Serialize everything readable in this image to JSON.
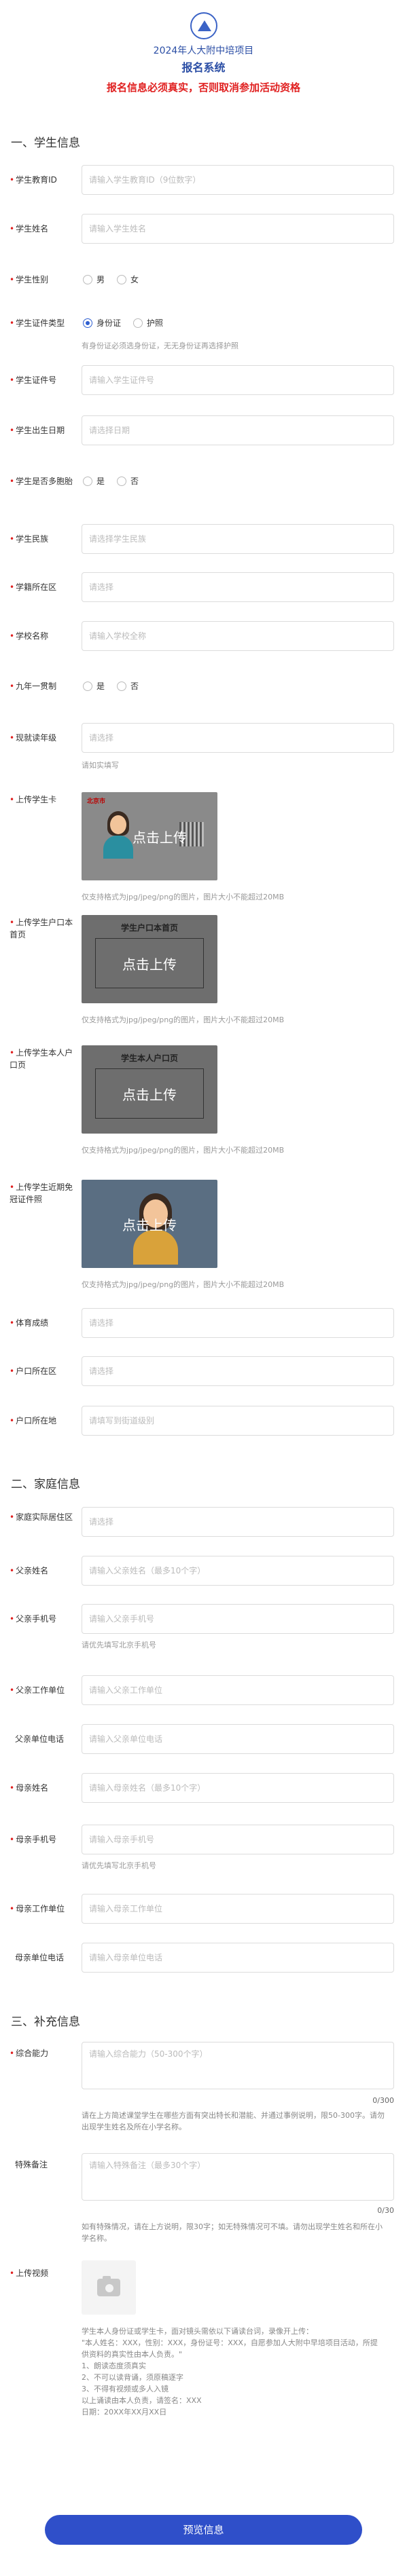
{
  "header": {
    "title": "2024年人大附中培项目",
    "subtitle": "报名系统",
    "notice": "报名信息必须真实，否则取消参加活动资格"
  },
  "sections": {
    "s1": "一、学生信息",
    "s2": "二、家庭信息",
    "s3": "三、补充信息"
  },
  "student": {
    "edu_id": {
      "label": "学生教育ID",
      "placeholder": "请输入学生教育ID（9位数字）"
    },
    "name": {
      "label": "学生姓名",
      "placeholder": "请输入学生姓名"
    },
    "gender": {
      "label": "学生性别",
      "options": [
        "男",
        "女"
      ]
    },
    "id_type": {
      "label": "学生证件类型",
      "options": [
        "身份证",
        "护照"
      ],
      "hint": "有身份证必须选身份证，无无身份证再选择护照"
    },
    "id_no": {
      "label": "学生证件号",
      "placeholder": "请输入学生证件号"
    },
    "birth": {
      "label": "学生出生日期",
      "placeholder": "请选择日期"
    },
    "multi_birth": {
      "label": "学生是否多胞胎",
      "options": [
        "是",
        "否"
      ]
    },
    "ethnic": {
      "label": "学生民族",
      "placeholder": "请选择学生民族"
    },
    "school_district": {
      "label": "学籍所在区",
      "placeholder": "请选择"
    },
    "school": {
      "label": "学校名称",
      "placeholder": "请输入学校全称"
    },
    "nine_year": {
      "label": "九年一贯制",
      "options": [
        "是",
        "否"
      ]
    },
    "grade": {
      "label": "现就读年级",
      "placeholder": "请选择",
      "hint": "请如实填写"
    },
    "student_card": {
      "label": "上传学生卡",
      "hint": "仅支持格式为jpg/jpeg/png的图片，图片大小不能超过20MB",
      "card_title": "北京市",
      "upload_text": "点击上传"
    },
    "hukou_home": {
      "label": "上传学生户口本首页",
      "hint": "仅支持格式为jpg/jpeg/png的图片，图片大小不能超过20MB",
      "card_title": "学生户口本首页",
      "upload_text": "点击上传"
    },
    "hukou_self": {
      "label": "上传学生本人户口页",
      "hint": "仅支持格式为jpg/jpeg/png的图片，图片大小不能超过20MB",
      "card_title": "学生本人户口页",
      "upload_text": "点击上传"
    },
    "photo": {
      "label": "上传学生近期免冠证件照",
      "hint": "仅支持格式为jpg/jpeg/png的图片，图片大小不能超过20MB",
      "upload_text": "点击上传"
    },
    "sports": {
      "label": "体育成绩",
      "placeholder": "请选择"
    },
    "hukou_district": {
      "label": "户口所在区",
      "placeholder": "请选择"
    },
    "hukou_address": {
      "label": "户口所在地",
      "placeholder": "请填写到街道级别"
    }
  },
  "family": {
    "home_district": {
      "label": "家庭实际居住区",
      "placeholder": "请选择"
    },
    "father_name": {
      "label": "父亲姓名",
      "placeholder": "请输入父亲姓名（最多10个字）"
    },
    "father_phone": {
      "label": "父亲手机号",
      "placeholder": "请输入父亲手机号",
      "hint": "请优先填写北京手机号"
    },
    "father_work": {
      "label": "父亲工作单位",
      "placeholder": "请输入父亲工作单位"
    },
    "father_work_phone": {
      "label": "父亲单位电话",
      "placeholder": "请输入父亲单位电话"
    },
    "mother_name": {
      "label": "母亲姓名",
      "placeholder": "请输入母亲姓名（最多10个字）"
    },
    "mother_phone": {
      "label": "母亲手机号",
      "placeholder": "请输入母亲手机号",
      "hint": "请优先填写北京手机号"
    },
    "mother_work": {
      "label": "母亲工作单位",
      "placeholder": "请输入母亲工作单位"
    },
    "mother_work_phone": {
      "label": "母亲单位电话",
      "placeholder": "请输入母亲单位电话"
    }
  },
  "extra": {
    "ability": {
      "label": "综合能力",
      "placeholder": "请输入综合能力（50-300个字）",
      "counter": "0/300",
      "desc": "请在上方简述课堂学生在哪些方面有突出特长和潜能、并通过事例说明，限50-300字。请勿出现学生姓名及所在小学名称。"
    },
    "remark": {
      "label": "特殊备注",
      "placeholder": "请输入特殊备注（最多30个字）",
      "counter": "0/30",
      "desc": "如有特殊情况，请在上方说明，限30字；如无特殊情况可不填。请勿出现学生姓名和所在小学名称。"
    },
    "video": {
      "label": "上传视频",
      "note": "学生本人身份证或学生卡，面对镜头需依以下诵读台词，录像开上传：\n\"本人姓名：XXX，性别：XXX，身份证号：XXX，自愿参加人大附中早培项目活动，所提供资料的真实性由本人负责。\"\n1、朗读态度须真实\n2、不可以读背诵，须原稿逐字\n3、不得有视频或多人入镜\n以上诵读由本人负责，请签名：XXX\n日期：20XX年XX月XX日"
    }
  },
  "submit_label": "预览信息"
}
